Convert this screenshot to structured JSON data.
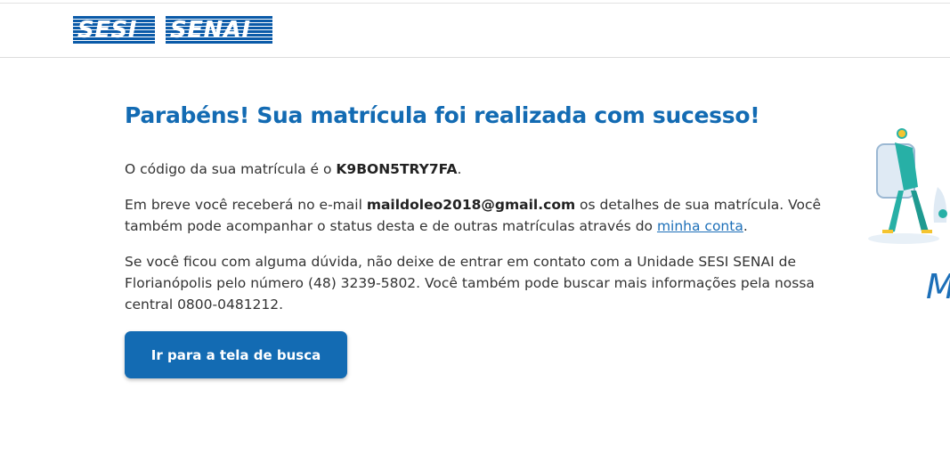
{
  "header": {
    "logo_sesi": "SESI",
    "logo_senai": "SENAI"
  },
  "main": {
    "title": "Parabéns! Sua matrícula foi realizada com sucesso!",
    "p1_prefix": "O código da sua matrícula é o ",
    "enrollment_code": "K9BON5TRY7FA",
    "p1_suffix": ".",
    "p2_prefix": "Em breve você receberá no e-mail ",
    "email": "maildoleo2018@gmail.com",
    "p2_middle": " os detalhes de sua matrícula. Você também pode acompanhar o status desta e de outras matrículas através do ",
    "account_link": "minha conta",
    "p2_suffix": ".",
    "p3": "Se você ficou com alguma dúvida, não deixe de entrar em contato com a Unidade SESI SENAI de Florianópolis pelo número (48) 3239-5802. Você também pode buscar mais informações pela nossa central 0800-0481212.",
    "button_label": "Ir para a tela de busca"
  },
  "side": {
    "partial_letter": "M"
  },
  "colors": {
    "brand_blue": "#136bb3",
    "logo_blue": "#0a5aa8"
  }
}
